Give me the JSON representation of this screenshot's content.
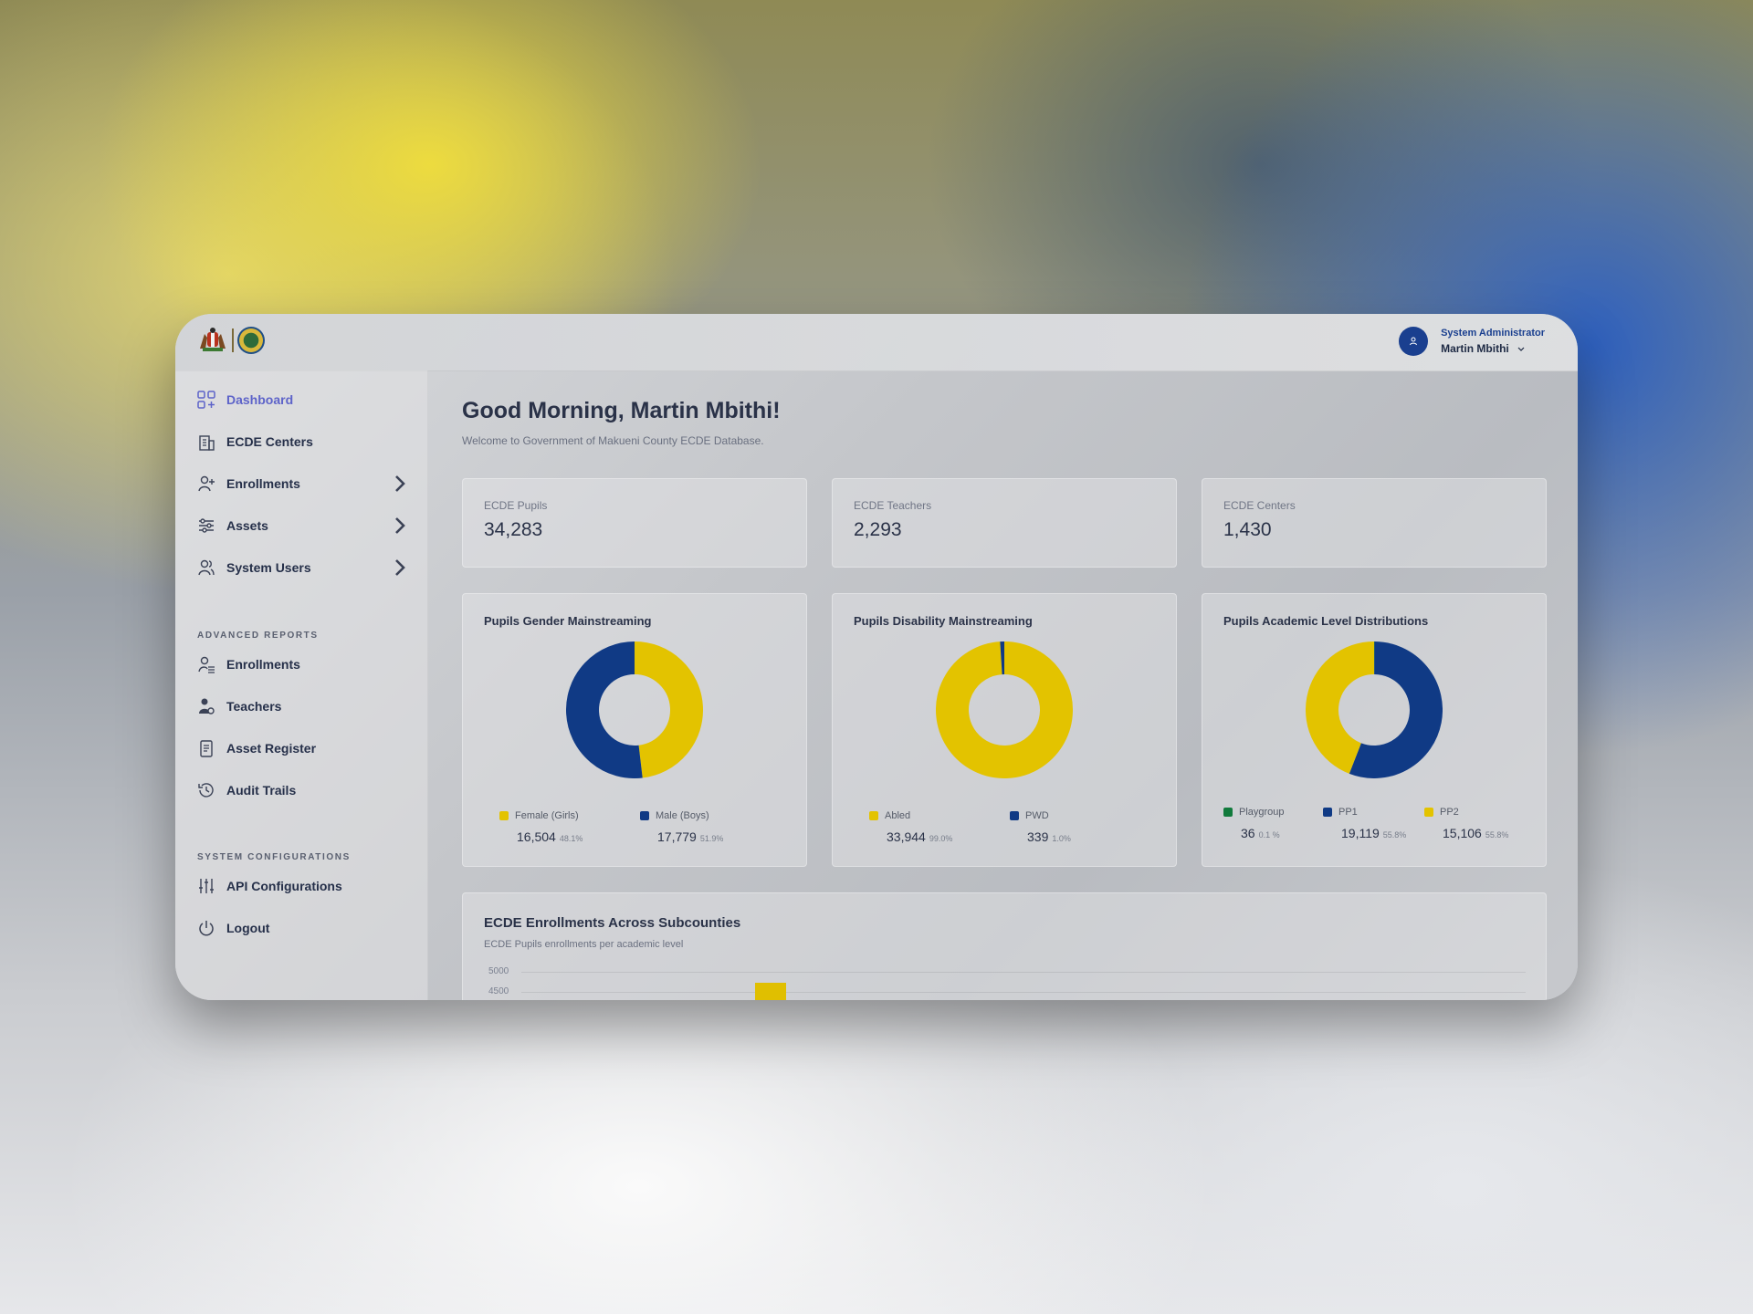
{
  "colors": {
    "yellow": "#e3c300",
    "navy": "#103a85",
    "green": "#117a3c",
    "accent": "#5d63c9"
  },
  "header": {
    "user_role": "System Administrator",
    "user_name": "Martin Mbithi"
  },
  "sidebar": {
    "items": [
      {
        "label": "Dashboard",
        "icon": "dashboard-icon"
      },
      {
        "label": "ECDE Centers",
        "icon": "building-icon"
      },
      {
        "label": "Enrollments",
        "icon": "user-plus-icon"
      },
      {
        "label": "Assets",
        "icon": "sliders-icon"
      },
      {
        "label": "System Users",
        "icon": "users-icon"
      }
    ],
    "advanced_label": "ADVANCED REPORTS",
    "advanced": [
      {
        "label": "Enrollments",
        "icon": "user-list-icon"
      },
      {
        "label": "Teachers",
        "icon": "teacher-icon"
      },
      {
        "label": "Asset Register",
        "icon": "register-icon"
      },
      {
        "label": "Audit Trails",
        "icon": "history-icon"
      }
    ],
    "config_label": "SYSTEM CONFIGURATIONS",
    "config": [
      {
        "label": "API Configurations",
        "icon": "adjust-icon"
      },
      {
        "label": "Logout",
        "icon": "power-icon"
      }
    ]
  },
  "greeting": "Good Morning, Martin Mbithi!",
  "welcome": "Welcome to Government of Makueni County ECDE Database.",
  "stats": [
    {
      "label": "ECDE Pupils",
      "value": "34,283"
    },
    {
      "label": "ECDE Teachers",
      "value": "2,293"
    },
    {
      "label": "ECDE Centers",
      "value": "1,430"
    }
  ],
  "chart_data": [
    {
      "type": "pie",
      "title": "Pupils Gender Mainstreaming",
      "series": [
        {
          "name": "Female (Girls)",
          "value": 16504,
          "pct": "48.1%",
          "color": "#e3c300"
        },
        {
          "name": "Male (Boys)",
          "value": 17779,
          "pct": "51.9%",
          "color": "#103a85"
        }
      ],
      "display_values": [
        "16,504",
        "17,779"
      ]
    },
    {
      "type": "pie",
      "title": "Pupils Disability Mainstreaming",
      "series": [
        {
          "name": "Abled",
          "value": 33944,
          "pct": "99.0%",
          "color": "#e3c300"
        },
        {
          "name": "PWD",
          "value": 339,
          "pct": "1.0%",
          "color": "#103a85"
        }
      ],
      "display_values": [
        "33,944",
        "339"
      ]
    },
    {
      "type": "pie",
      "title": "Pupils Academic Level Distributions",
      "series": [
        {
          "name": "Playgroup",
          "value": 36,
          "pct": "0.1 %",
          "color": "#117a3c"
        },
        {
          "name": "PP1",
          "value": 19119,
          "pct": "55.8%",
          "color": "#103a85"
        },
        {
          "name": "PP2",
          "value": 15106,
          "pct": "55.8%",
          "color": "#e3c300"
        }
      ],
      "display_values": [
        "36",
        "19,119",
        "15,106"
      ]
    },
    {
      "type": "bar",
      "title": "ECDE Enrollments Across Subcounties",
      "subtitle": "ECDE Pupils enrollments per academic level",
      "yticks": [
        "5000",
        "4500"
      ],
      "ylim": [
        4500,
        5000
      ],
      "values": [
        4500
      ]
    }
  ]
}
